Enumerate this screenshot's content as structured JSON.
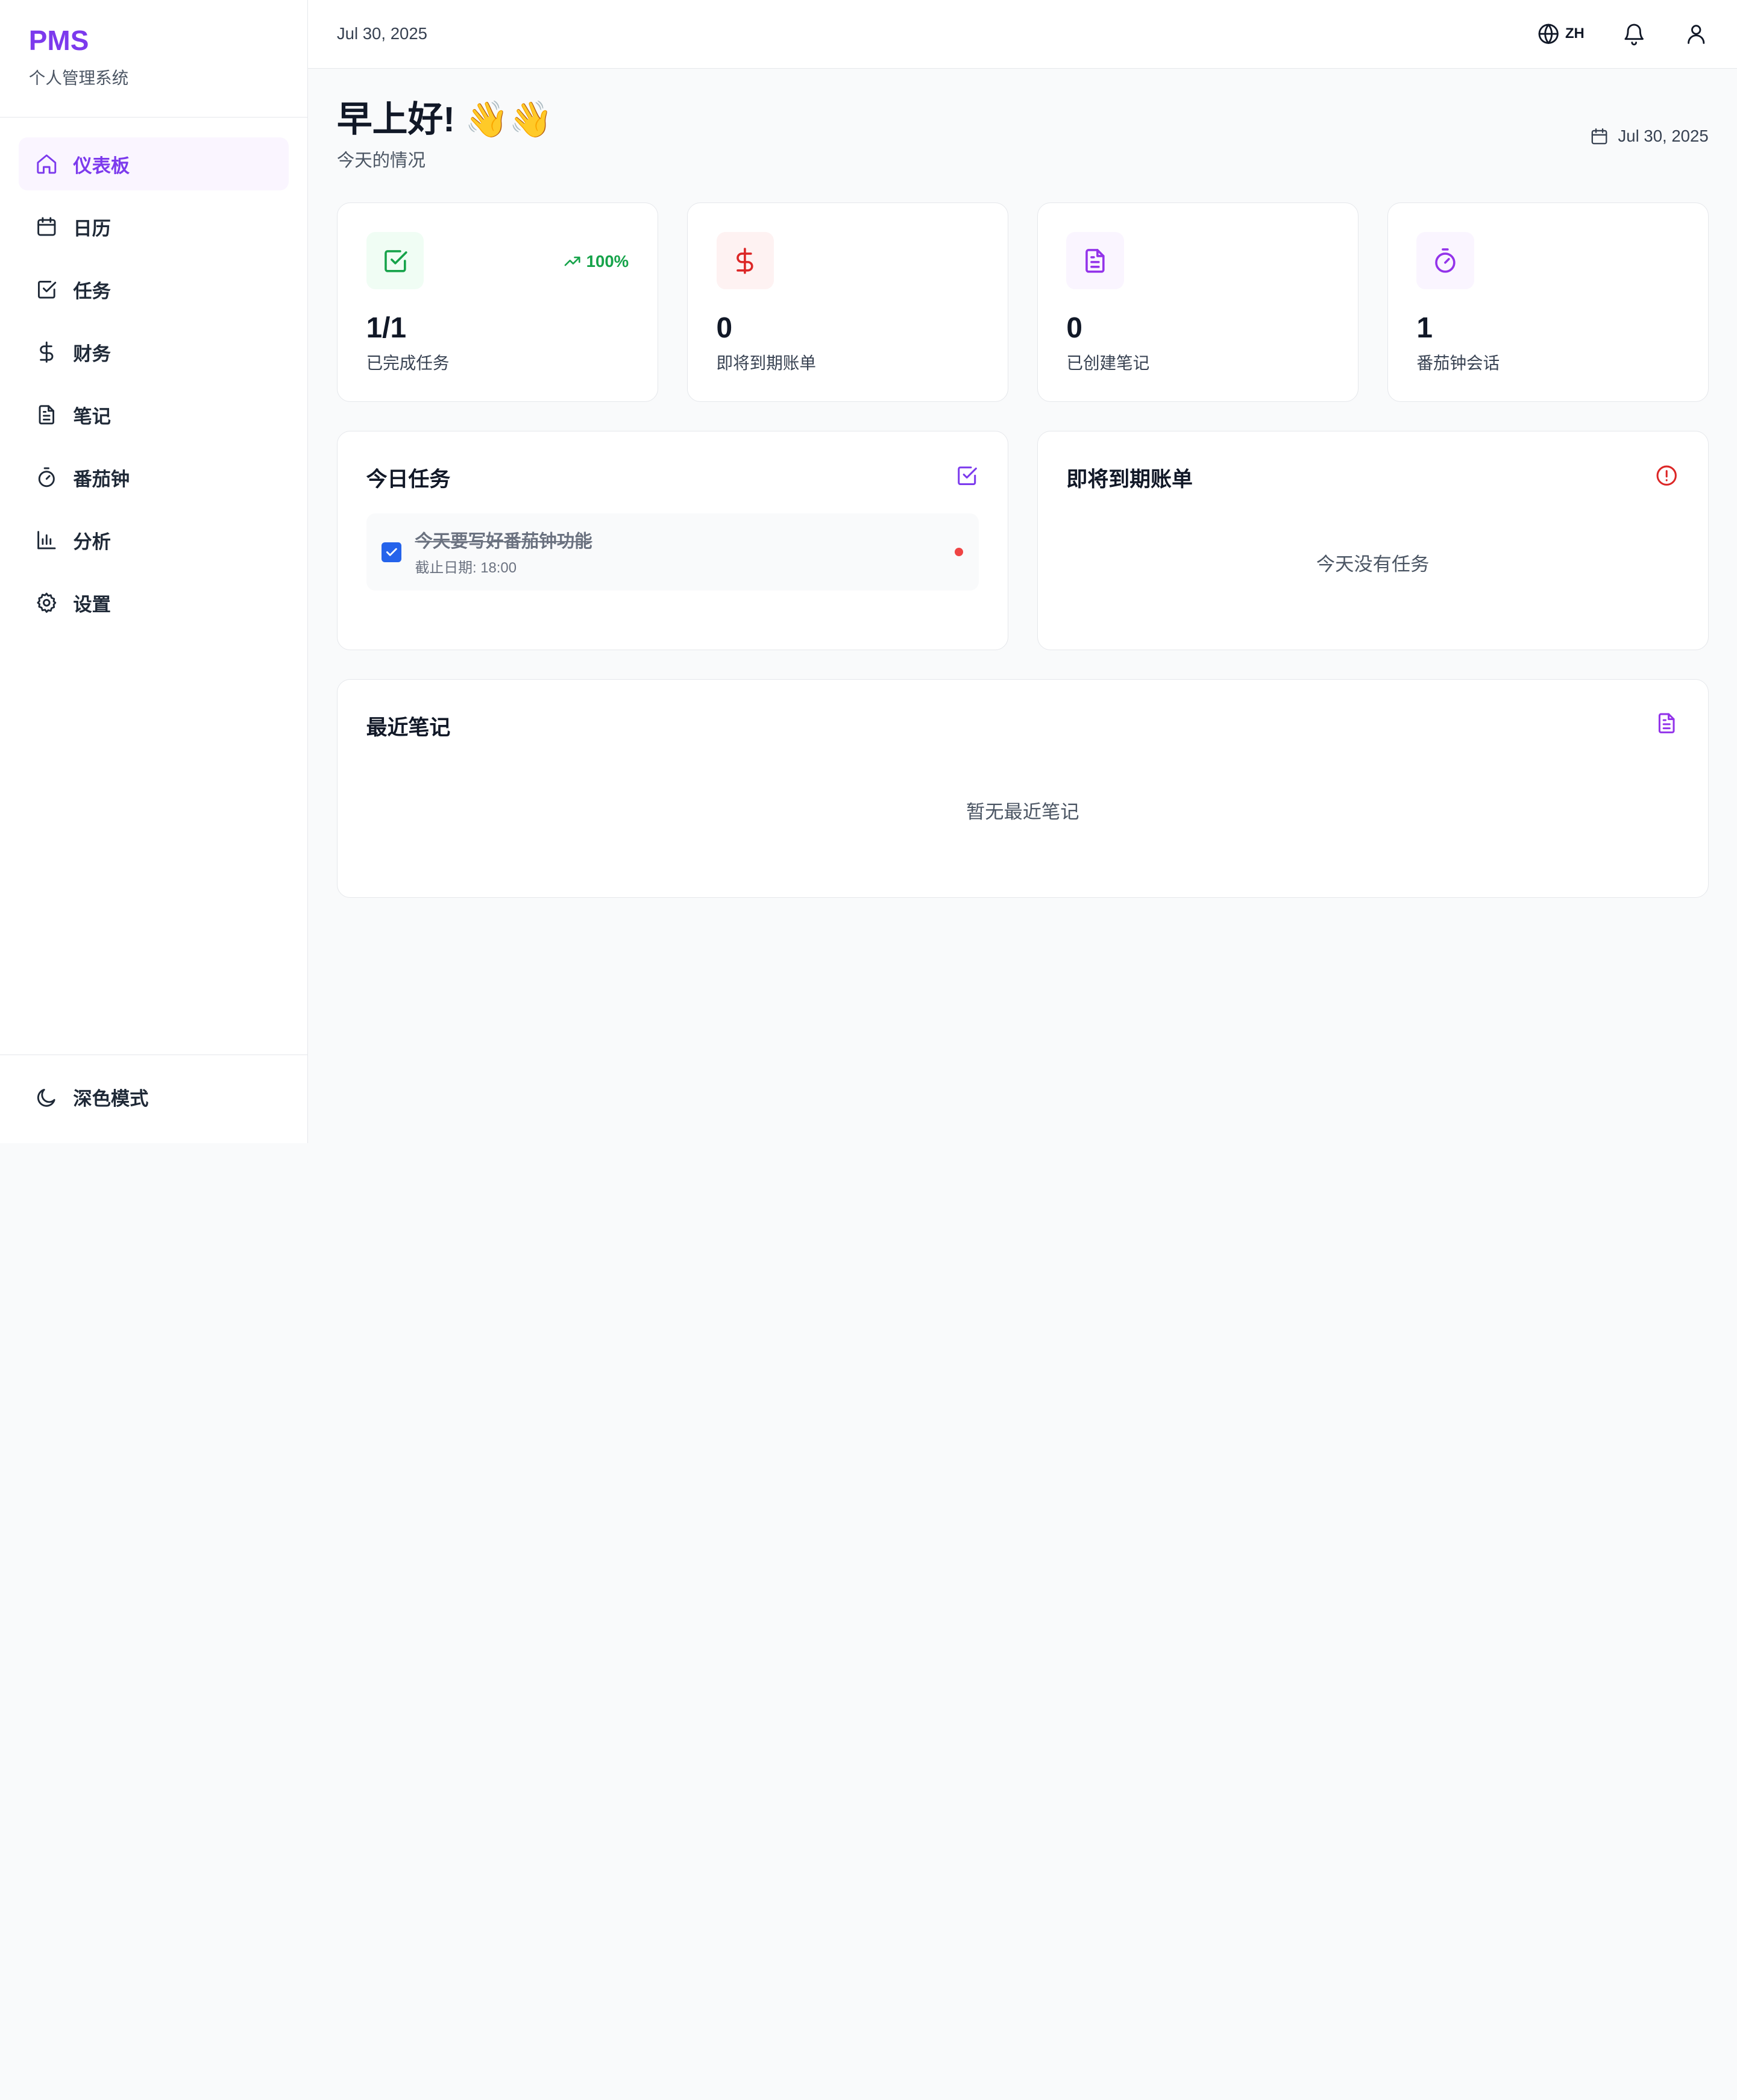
{
  "brand": {
    "title": "PMS",
    "subtitle": "个人管理系统"
  },
  "nav": {
    "items": [
      {
        "label": "仪表板",
        "icon": "home-icon",
        "active": true
      },
      {
        "label": "日历",
        "icon": "calendar-icon"
      },
      {
        "label": "任务",
        "icon": "check-square-icon"
      },
      {
        "label": "财务",
        "icon": "dollar-icon"
      },
      {
        "label": "笔记",
        "icon": "document-icon"
      },
      {
        "label": "番茄钟",
        "icon": "timer-icon"
      },
      {
        "label": "分析",
        "icon": "bar-chart-icon"
      },
      {
        "label": "设置",
        "icon": "gear-icon"
      }
    ],
    "dark_mode": "深色模式"
  },
  "topbar": {
    "date": "Jul 30, 2025",
    "language": "ZH"
  },
  "greeting": {
    "title": "早上好! 👋👋",
    "subtitle": "今天的情况",
    "date": "Jul 30, 2025"
  },
  "stats": [
    {
      "value": "1/1",
      "label": "已完成任务",
      "trend": "100%",
      "icon": "check-square-icon",
      "color": "#16a34a",
      "bg": "#f0fdf4"
    },
    {
      "value": "0",
      "label": "即将到期账单",
      "icon": "dollar-icon",
      "color": "#dc2626",
      "bg": "#fef2f2"
    },
    {
      "value": "0",
      "label": "已创建笔记",
      "icon": "document-icon",
      "color": "#9333ea",
      "bg": "#faf5ff"
    },
    {
      "value": "1",
      "label": "番茄钟会话",
      "icon": "timer-icon",
      "color": "#9333ea",
      "bg": "#faf5ff"
    }
  ],
  "today_tasks": {
    "title": "今日任务",
    "items": [
      {
        "title": "今天要写好番茄钟功能",
        "due": "截止日期: 18:00",
        "completed": true
      }
    ]
  },
  "upcoming_bills": {
    "title": "即将到期账单",
    "empty": "今天没有任务"
  },
  "recent_notes": {
    "title": "最近笔记",
    "empty": "暂无最近笔记"
  },
  "colors": {
    "accent": "#7c3aed",
    "success": "#16a34a",
    "danger": "#dc2626",
    "checkbox": "#2563eb"
  }
}
